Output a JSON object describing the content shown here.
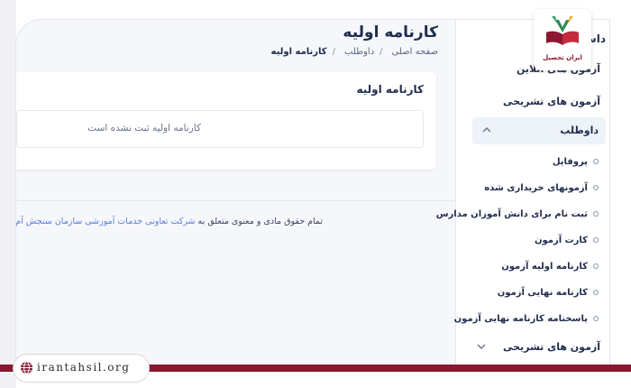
{
  "sidebar": {
    "top_partial": "داش",
    "item_partial": "آزمون های آنلاین",
    "item_descriptive": "آزمون های تشریحی",
    "active_section": "داوطلب",
    "sub_items": [
      "پروفایل",
      "آزمونهای خریداری شده",
      "ثبت نام برای دانش آموزان مدارس",
      "کارت آزمون",
      "کارنامه اولیه آزمون",
      "کارنامه نهایی آزمون",
      "پاسخنامه کارنامه نهایی آزمون"
    ],
    "bottom_item": "آزمون های تشریحی"
  },
  "main": {
    "title": "کارنامه اولیه",
    "breadcrumb": {
      "home": "صفحه اصلی",
      "parent": "داوطلب",
      "current": "کارنامه اولیه"
    },
    "card": {
      "title": "کارنامه اولیه",
      "empty_message": "کارنامه اولیه ثبت نشده است"
    }
  },
  "footer": {
    "text": "تمام حقوق مادی و معنوی متعلق به",
    "link": "شرکت تعاونی خدمات آموزشی سازمان سنجش آم"
  },
  "branding": {
    "logo_text": "ایران تحصیل",
    "url": "irantahsil.org",
    "accent_color": "#8c1730"
  }
}
